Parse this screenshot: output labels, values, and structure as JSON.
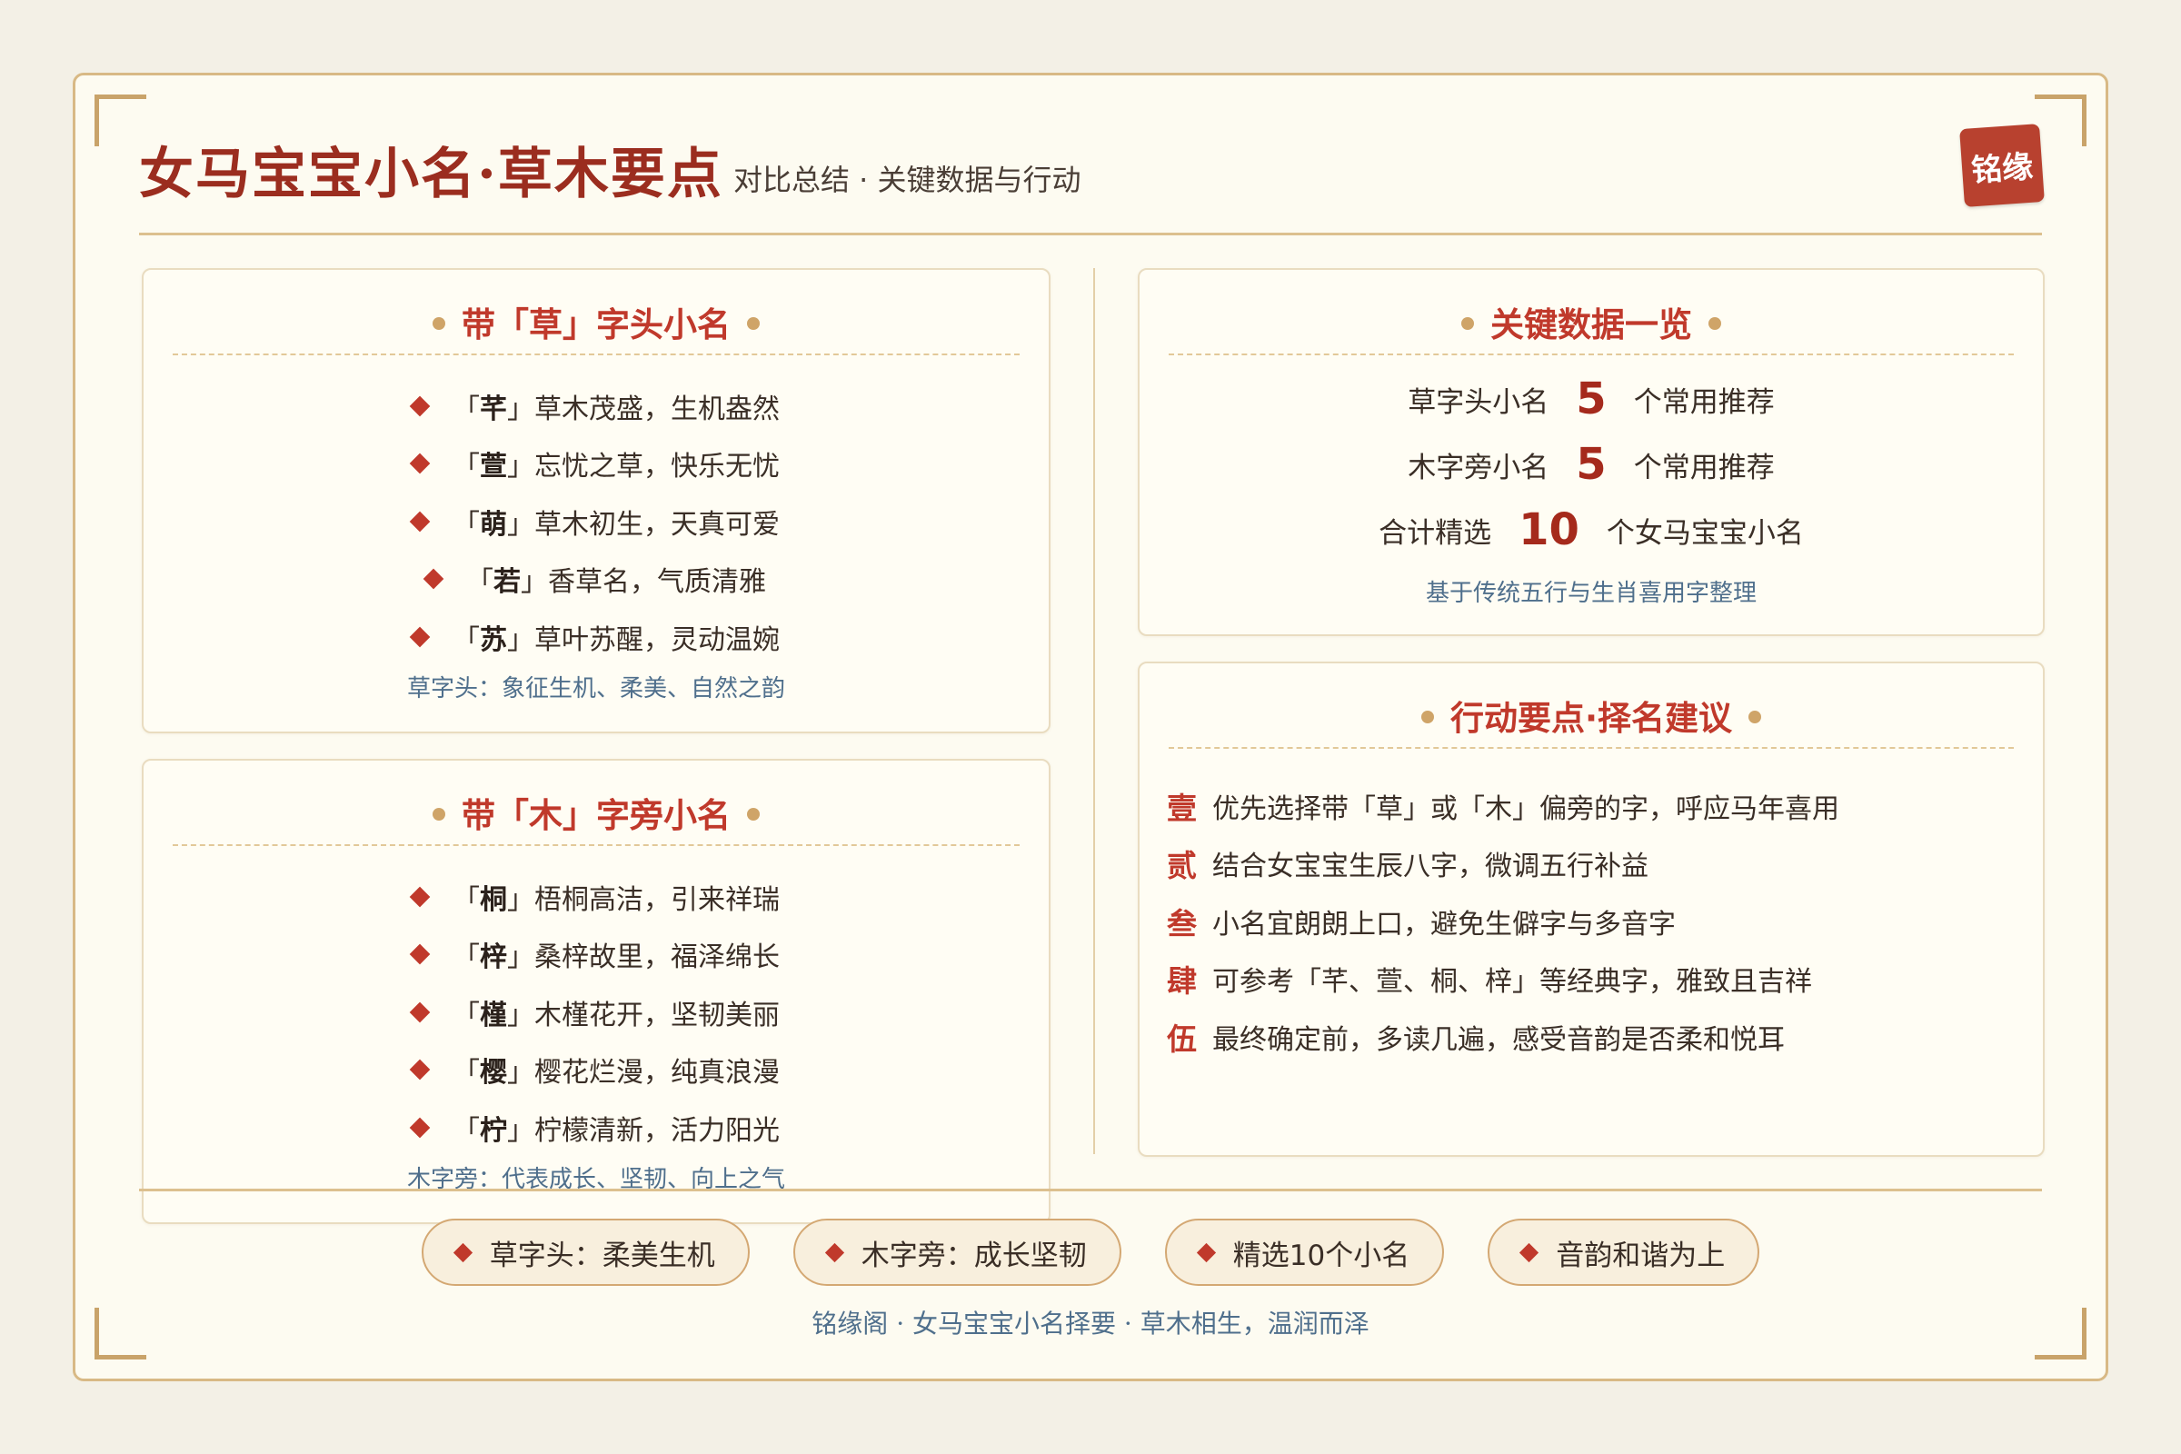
{
  "header": {
    "title": "女马宝宝小名·草木要点",
    "subtitle": "对比总结 · 关键数据与行动",
    "seal": "铭缘"
  },
  "cao_card": {
    "title": "带「草」字头小名",
    "items": [
      {
        "open": "「",
        "char": "芊",
        "close": "」",
        "desc": "草木茂盛，生机盎然"
      },
      {
        "open": "「",
        "char": "萱",
        "close": "」",
        "desc": "忘忧之草，快乐无忧"
      },
      {
        "open": "「",
        "char": "萌",
        "close": "」",
        "desc": "草木初生，天真可爱"
      },
      {
        "open": "「",
        "char": "若",
        "close": "」",
        "desc": "香草名，气质清雅"
      },
      {
        "open": "「",
        "char": "苏",
        "close": "」",
        "desc": "草叶苏醒，灵动温婉"
      }
    ],
    "note": "草字头：象征生机、柔美、自然之韵"
  },
  "mu_card": {
    "title": "带「木」字旁小名",
    "items": [
      {
        "open": "「",
        "char": "桐",
        "close": "」",
        "desc": "梧桐高洁，引来祥瑞"
      },
      {
        "open": "「",
        "char": "梓",
        "close": "」",
        "desc": "桑梓故里，福泽绵长"
      },
      {
        "open": "「",
        "char": "槿",
        "close": "」",
        "desc": "木槿花开，坚韧美丽"
      },
      {
        "open": "「",
        "char": "樱",
        "close": "」",
        "desc": "樱花烂漫，纯真浪漫"
      },
      {
        "open": "「",
        "char": "柠",
        "close": "」",
        "desc": "柠檬清新，活力阳光"
      }
    ],
    "note": "木字旁：代表成长、坚韧、向上之气"
  },
  "stats_card": {
    "title": "关键数据一览",
    "rows": [
      {
        "label": "草字头小名",
        "value": "5",
        "suffix": "个常用推荐"
      },
      {
        "label": "木字旁小名",
        "value": "5",
        "suffix": "个常用推荐"
      },
      {
        "label": "合计精选",
        "value": "10",
        "suffix": "个女马宝宝小名"
      }
    ],
    "note": "基于传统五行与生肖喜用字整理"
  },
  "action_card": {
    "title": "行动要点·择名建议",
    "items": [
      {
        "index": "壹",
        "text": "优先选择带「草」或「木」偏旁的字，呼应马年喜用"
      },
      {
        "index": "贰",
        "text": "结合女宝宝生辰八字，微调五行补益"
      },
      {
        "index": "叁",
        "text": "小名宜朗朗上口，避免生僻字与多音字"
      },
      {
        "index": "肆",
        "text": "可参考「芊、萱、桐、梓」等经典字，雅致且吉祥"
      },
      {
        "index": "伍",
        "text": "最终确定前，多读几遍，感受音韵是否柔和悦耳"
      }
    ]
  },
  "tags": [
    "草字头：柔美生机",
    "木字旁：成长坚韧",
    "精选10个小名",
    "音韵和谐为上"
  ],
  "footer": "铭缘阁 · 女马宝宝小名择要 · 草木相生，温润而泽",
  "colors": {
    "accent": "#c0392b",
    "title": "#9b2d1f",
    "gold": "#d8b985",
    "note_blue": "#4f6f8c",
    "background": "#fdfbf1"
  }
}
